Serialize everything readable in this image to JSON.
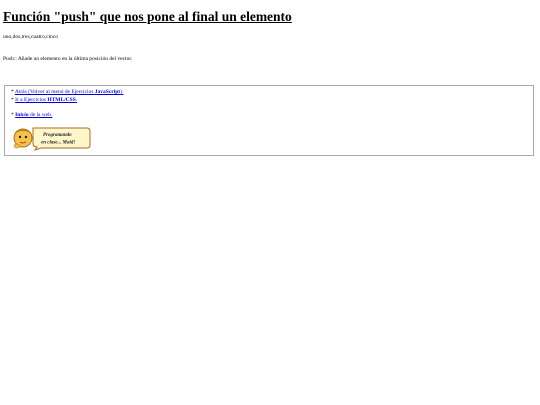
{
  "page": {
    "title": "Función \"push\" que nos pone al final un elemento",
    "output": "uno,dos,tres,cuatro,cinco",
    "description": "Push:: Añade un elemento en la última posición del vector."
  },
  "nav": {
    "bullet": "*",
    "back_link_prefix": "Atrás (Volver al menú de Ejercicios ",
    "back_link_bold": "JavaScript",
    "back_link_suffix": ").",
    "html_link_prefix": "Ir a Ejercicios ",
    "html_link_bold": "HTML/CSS",
    "html_link_suffix": ".",
    "home_link_bold": "Inicio",
    "home_link_suffix": " de la web."
  },
  "logo": {
    "line1": "Programando",
    "line2": "en clase... Maid!"
  }
}
